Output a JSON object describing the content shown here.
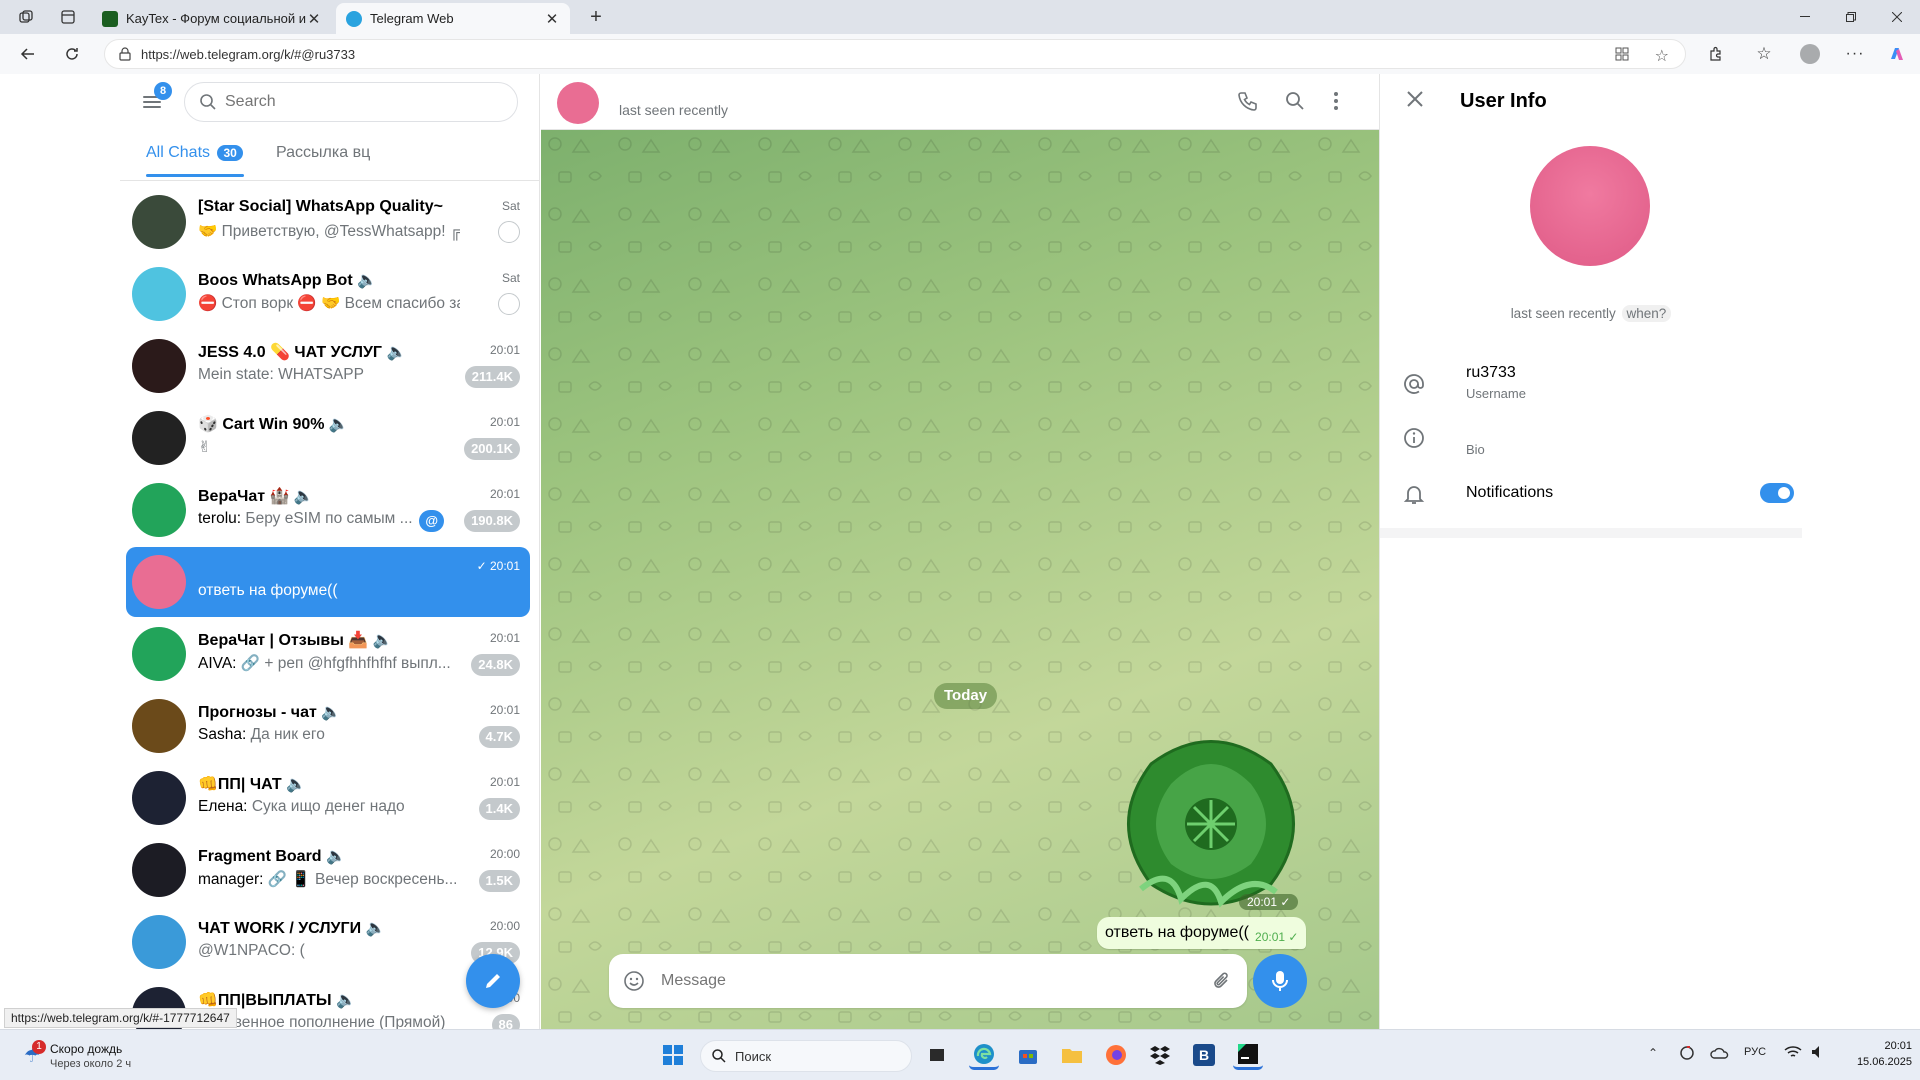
{
  "browser": {
    "tabs": [
      {
        "title": "KayTex - Форум социальной инж",
        "favicon_color": "#1b5e20"
      },
      {
        "title": "Telegram Web",
        "favicon_color": "#2aa3df",
        "active": true
      }
    ],
    "address": "https://web.telegram.org/k/#@ru3733",
    "status_url": "https://web.telegram.org/k/#-1777712647"
  },
  "left": {
    "menu_badge": "8",
    "search_placeholder": "Search",
    "tabs": [
      {
        "label": "All Chats",
        "count": "30",
        "active": true
      },
      {
        "label": "Рассылка вц"
      }
    ],
    "chats": [
      {
        "name": "[Star Social] WhatsApp Quality~",
        "time": "Sat",
        "sender": "",
        "message": "🤝 Приветствую, @TessWhatsapp! ╔ ...",
        "badge": "",
        "pinned": true,
        "avatar_color": "#3a4a3a"
      },
      {
        "name": "Boos WhatsApp Bot 🔈",
        "time": "Sat",
        "sender": "",
        "message": "⛔ Стоп ворк ⛔ 🤝 Всем спасибо за р...",
        "badge": "",
        "pinned": true,
        "avatar_color": "#4fc3e0"
      },
      {
        "name": "JESS 4.0 💊 ЧАТ УСЛУГ 🔈",
        "time": "20:01",
        "sender": "",
        "message": "Mein state: WHATSAPP",
        "badge": "211.4K",
        "pinned": false,
        "avatar_color": "#2b1a1a"
      },
      {
        "name": "🎲 Cart Win 90% 🔈",
        "time": "20:01",
        "sender": "",
        "message": "✌",
        "badge": "200.1K",
        "pinned": false,
        "avatar_color": "#222"
      },
      {
        "name": "ВераЧат 🏰 🔈",
        "time": "20:01",
        "sender": "terolu:",
        "message": "Беру eSIM по самым ...",
        "badge": "190.8K",
        "mention": "@",
        "pinned": false,
        "avatar_color": "#22a45a"
      },
      {
        "name": "",
        "time": "✓ 20:01",
        "sender": "",
        "message": "ответь на форуме((",
        "badge": "",
        "pinned": false,
        "selected": true,
        "avatar_color": "#e96d93"
      },
      {
        "name": "ВераЧат | Отзывы 📥 🔈",
        "time": "20:01",
        "sender": "AIVA:",
        "message": "🔗 + реп @hfgfhhfhfhf выпл...",
        "badge": "24.8K",
        "pinned": false,
        "avatar_color": "#22a45a"
      },
      {
        "name": "Прогнозы - чат 🔈",
        "time": "20:01",
        "sender": "Sasha:",
        "message": "Да ник его",
        "badge": "4.7K",
        "pinned": false,
        "avatar_color": "#6b4a1a"
      },
      {
        "name": "👊ПП| ЧАТ 🔈",
        "time": "20:01",
        "sender": "Елена:",
        "message": "Сука ищо денег надо",
        "badge": "1.4K",
        "pinned": false,
        "avatar_color": "#1d2233"
      },
      {
        "name": "Fragment Board 🔈",
        "time": "20:00",
        "sender": "manager:",
        "message": "🔗 📱 Вечер воскресень...",
        "badge": "1.5K",
        "pinned": false,
        "avatar_color": "#1c1c24"
      },
      {
        "name": "ЧАТ WORK / УСЛУГИ 🔈",
        "time": "20:00",
        "sender": "",
        "message": "@W1NPACO: (",
        "badge": "12.9K",
        "pinned": false,
        "avatar_color": "#3a9ad9"
      },
      {
        "name": "👊ПП|ВЫПЛАТЫ 🔈",
        "time": "20:00",
        "sender": "",
        "message": "Мгновенное пополнение (Прямой)",
        "badge": "86",
        "pinned": false,
        "avatar_color": "#1d2233"
      }
    ]
  },
  "chat": {
    "header_status": "last seen recently",
    "date_pill": "Today",
    "sticker_time": "20:01",
    "message_text": "ответь на форуме((",
    "message_time": "20:01",
    "input_placeholder": "Message"
  },
  "user_info": {
    "title": "User Info",
    "status": "last seen recently",
    "status_link": "when?",
    "username": "ru3733",
    "username_label": "Username",
    "bio_label": "Bio",
    "notifications_label": "Notifications",
    "notifications_on": true,
    "avatar_color": "#e96d93",
    "accent_color": "#3390ec"
  },
  "taskbar": {
    "weather_title": "Скоро дождь",
    "weather_sub": "Через около 2 ч",
    "weather_badge": "1",
    "search_placeholder": "Поиск",
    "lang": "РУС",
    "clock_time": "20:01",
    "clock_date": "15.06.2025"
  }
}
